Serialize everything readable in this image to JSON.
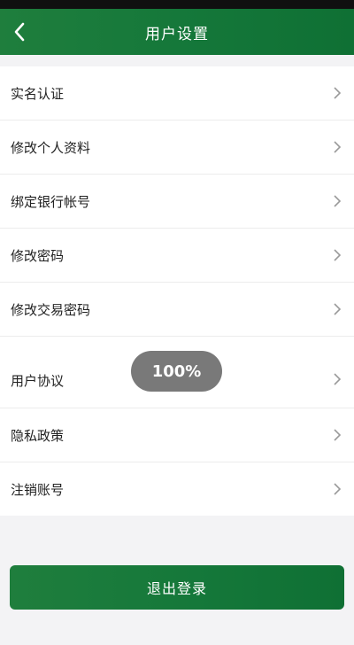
{
  "header": {
    "title": "用户设置",
    "back_icon": "chevron-left-icon"
  },
  "menu": {
    "items": [
      {
        "label": "实名认证"
      },
      {
        "label": "修改个人资料"
      },
      {
        "label": "绑定银行帐号"
      },
      {
        "label": "修改密码"
      },
      {
        "label": "修改交易密码"
      },
      {
        "label": "用户协议"
      },
      {
        "label": "隐私政策"
      },
      {
        "label": "注销账号"
      }
    ],
    "chevron_icon": "chevron-right-icon"
  },
  "toast": {
    "text": "100%"
  },
  "footer": {
    "logout_label": "退出登录"
  },
  "colors": {
    "brand_green": "#15783a",
    "toast_bg": "#6e6e6e"
  }
}
